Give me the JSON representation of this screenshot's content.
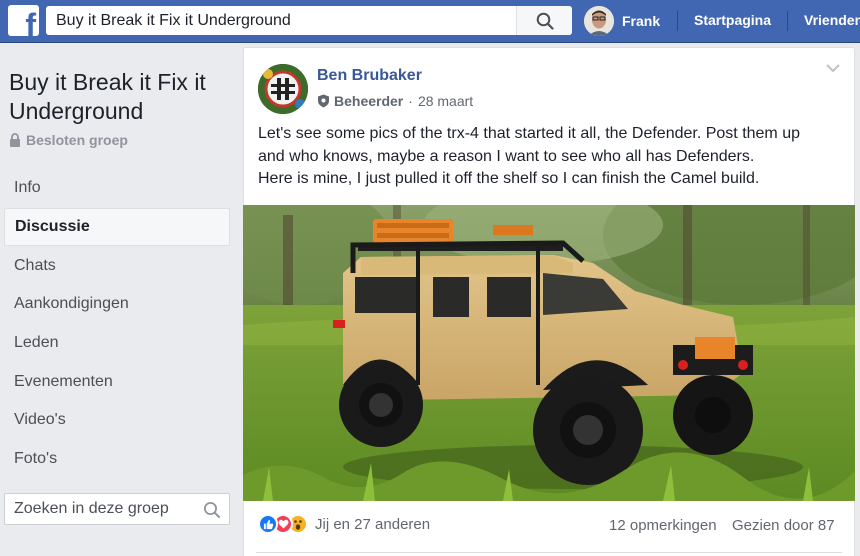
{
  "topbar": {
    "logo_letter": "f",
    "search_value": "Buy it Break it Fix it Underground",
    "user_name": "Frank",
    "nav_home": "Startpagina",
    "nav_friends": "Vrienden"
  },
  "group": {
    "title": "Buy it Break it Fix it Underground",
    "type": "Besloten groep",
    "nav": [
      {
        "label": "Info",
        "active": false
      },
      {
        "label": "Discussie",
        "active": true
      },
      {
        "label": "Chats",
        "active": false
      },
      {
        "label": "Aankondigingen",
        "active": false
      },
      {
        "label": "Leden",
        "active": false
      },
      {
        "label": "Evenementen",
        "active": false
      },
      {
        "label": "Video's",
        "active": false
      },
      {
        "label": "Foto's",
        "active": false
      }
    ],
    "search_placeholder": "Zoeken in deze groep"
  },
  "post": {
    "author": "Ben Brubaker",
    "role": "Beheerder",
    "separator": "·",
    "date": "28 maart",
    "text_lines": [
      "Let's see some pics of the trx-4 that started it all, the Defender. Post them up",
      "and who knows, maybe a reason I want to see who all has Defenders.",
      "Here is mine, I just pulled it off the shelf so I can finish the Camel build."
    ],
    "reactions_text": "Jij en 27 anderen",
    "comments": "12 opmerkingen",
    "views": "Gezien door 87"
  },
  "colors": {
    "brand": "#4267b2",
    "link": "#385898",
    "like": "#1877f2",
    "love": "#f33e58",
    "wow": "#f7b125"
  },
  "icons": [
    "search-icon",
    "lock-icon",
    "shield-icon",
    "chevron-down-icon",
    "like-reaction-icon",
    "love-reaction-icon",
    "wow-reaction-icon"
  ]
}
